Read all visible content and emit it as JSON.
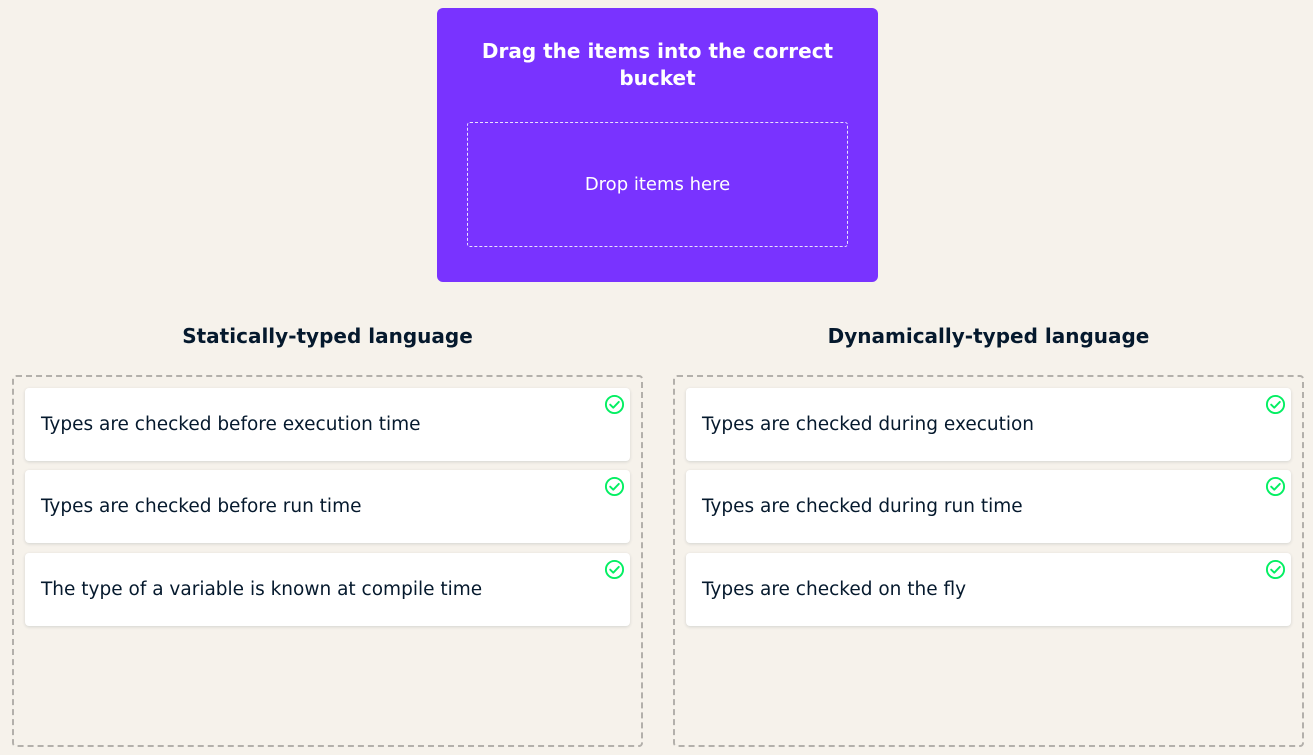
{
  "source": {
    "title": "Drag the items into the correct bucket",
    "drop_placeholder": "Drop items here"
  },
  "buckets": [
    {
      "heading": "Statically-typed language",
      "items": [
        {
          "label": "Types are checked before execution time",
          "status": "correct"
        },
        {
          "label": "Types are checked before run time",
          "status": "correct"
        },
        {
          "label": "The type of a variable is known at compile time",
          "status": "correct"
        }
      ]
    },
    {
      "heading": "Dynamically-typed language",
      "items": [
        {
          "label": "Types are checked during execution",
          "status": "correct"
        },
        {
          "label": "Types are checked during run time",
          "status": "correct"
        },
        {
          "label": "Types are checked on the fly",
          "status": "correct"
        }
      ]
    }
  ],
  "colors": {
    "background": "#f6f2eb",
    "accent": "#7933ff",
    "correct": "#03ef62",
    "text": "#05192d"
  },
  "icons": {
    "status": "check-circle-icon"
  }
}
